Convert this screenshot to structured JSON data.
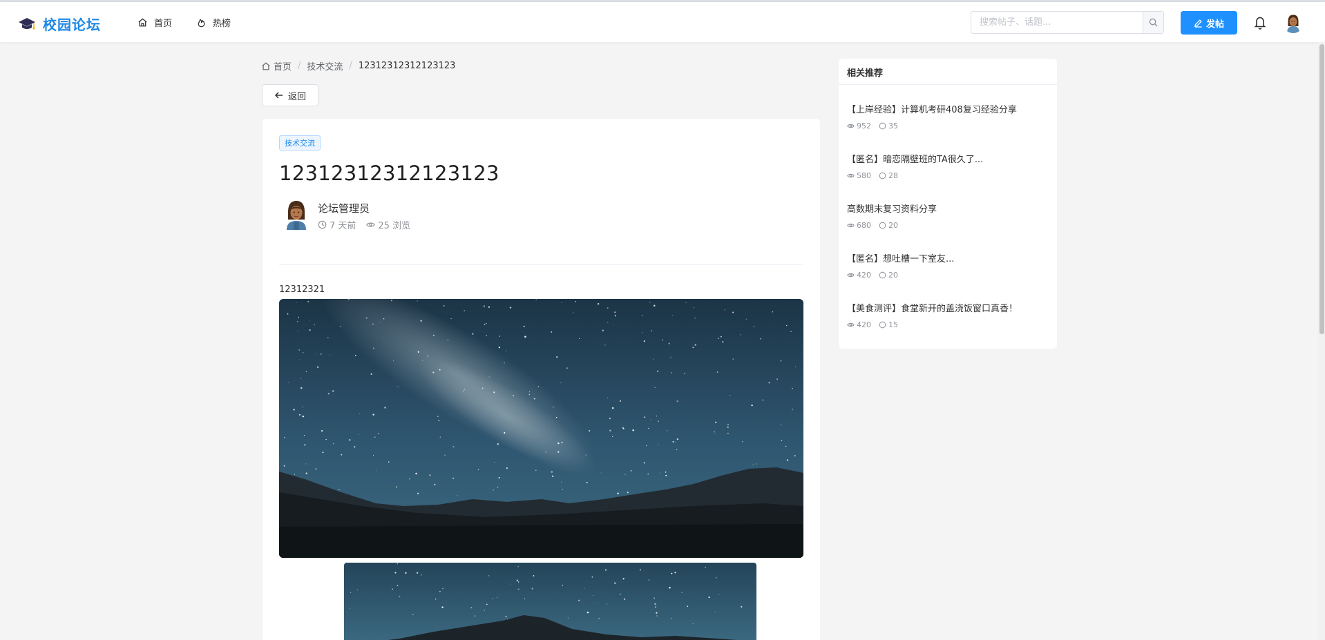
{
  "header": {
    "logo_text": "校园论坛",
    "nav": [
      {
        "label": "首页",
        "icon": "home-icon"
      },
      {
        "label": "热榜",
        "icon": "fire-icon"
      }
    ],
    "search_placeholder": "搜索帖子、话题...",
    "post_button_label": "发帖"
  },
  "breadcrumb": {
    "items": [
      "首页",
      "技术交流",
      "12312312312123123"
    ],
    "separator": "/"
  },
  "back_button_label": "返回",
  "post": {
    "tag": "技术交流",
    "title": "12312312312123123",
    "author": "论坛管理员",
    "time": "7 天前",
    "views": "25 浏览",
    "content": "12312321"
  },
  "recommendations": {
    "title": "相关推荐",
    "items": [
      {
        "title": "【上岸经验】计算机考研408复习经验分享",
        "views": "952",
        "comments": "35"
      },
      {
        "title": "【匿名】暗恋隔壁班的TA很久了...",
        "views": "580",
        "comments": "28"
      },
      {
        "title": "高数期末复习资料分享",
        "views": "680",
        "comments": "20"
      },
      {
        "title": "【匿名】想吐槽一下室友...",
        "views": "420",
        "comments": "20"
      },
      {
        "title": "【美食测评】食堂新开的盖浇饭窗口真香！",
        "views": "420",
        "comments": "15"
      }
    ]
  },
  "colors": {
    "brand": "#1e88e5",
    "primary_button": "#1e90ff",
    "page_background": "#f4f4f5"
  }
}
